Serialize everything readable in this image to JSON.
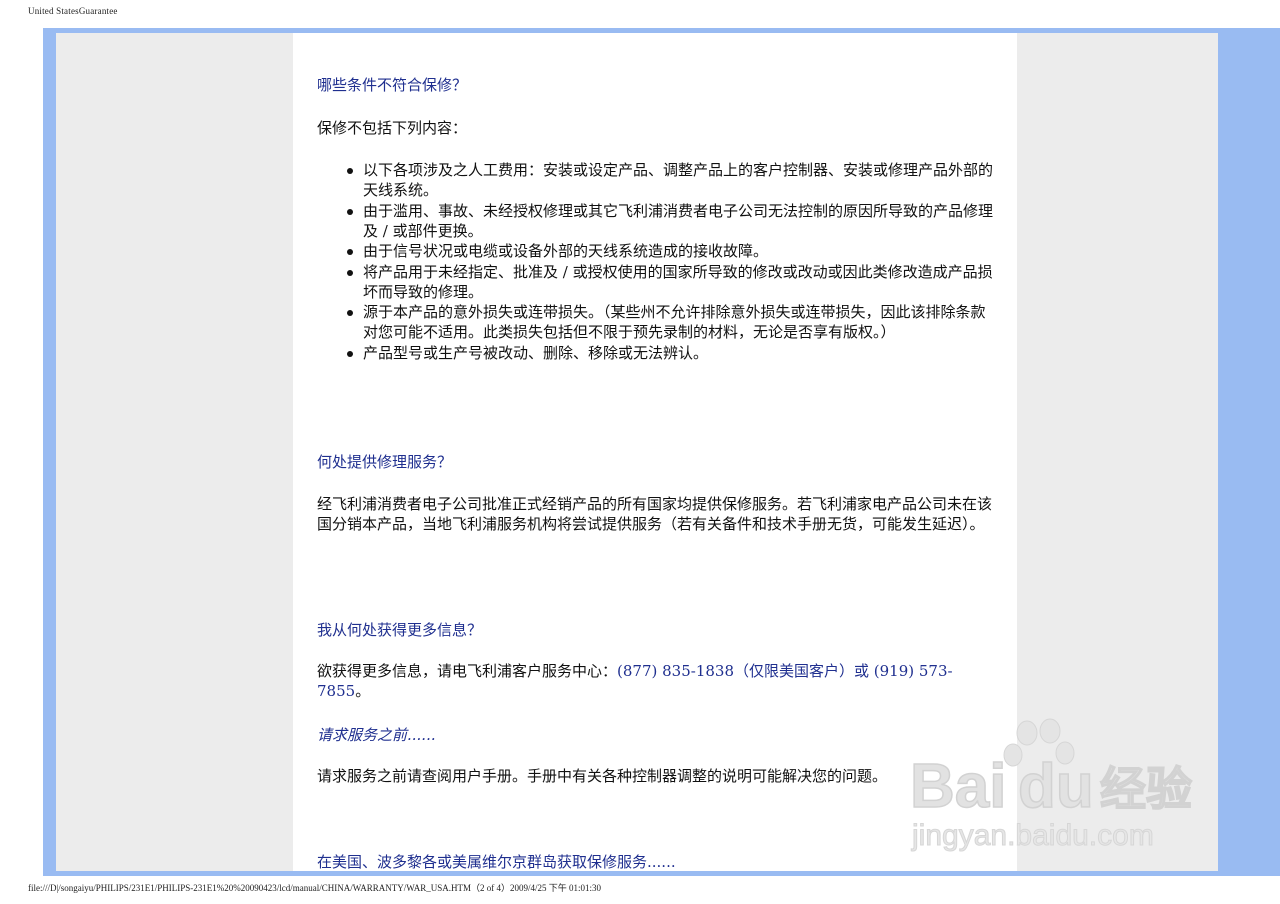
{
  "header": {
    "title": "United StatesGuarantee"
  },
  "sections": {
    "not_covered": {
      "heading": "哪些条件不符合保修？",
      "intro": "保修不包括下列内容：",
      "items": [
        "以下各项涉及之人工费用：安装或设定产品、调整产品上的客户控制器、安装或修理产品外部的天线系统。",
        "由于滥用、事故、未经授权修理或其它飞利浦消费者电子公司无法控制的原因所导致的产品修理及 / 或部件更换。",
        "由于信号状况或电缆或设备外部的天线系统造成的接收故障。",
        "将产品用于未经指定、批准及 / 或授权使用的国家所导致的修改或改动或因此类修改造成产品损坏而导致的修理。",
        "源于本产品的意外损失或连带损失。（某些州不允许排除意外损失或连带损失，因此该排除条款对您可能不适用。此类损失包括但不限于预先录制的材料，无论是否享有版权。）",
        "产品型号或生产号被改动、删除、移除或无法辨认。"
      ]
    },
    "where_service": {
      "heading": "何处提供修理服务？",
      "body": "经飞利浦消费者电子公司批准正式经销产品的所有国家均提供保修服务。若飞利浦家电产品公司未在该国分销本产品，当地飞利浦服务机构将尝试提供服务（若有关备件和技术手册无货，可能发生延迟）。"
    },
    "more_info": {
      "heading": "我从何处获得更多信息？",
      "body_prefix": "欲获得更多信息，请电飞利浦客户服务中心：",
      "phone_link": "(877) 835-1838（仅限美国客户）或 (919) 573-7855",
      "body_suffix": "。"
    },
    "before_service": {
      "heading": "请求服务之前......",
      "body": "请求服务之前请查阅用户手册。手册中有关各种控制器调整的说明可能解决您的问题。"
    },
    "usa_service": {
      "heading": "在美国、波多黎各或美属维尔京群岛获取保修服务......"
    }
  },
  "watermark": {
    "brand": "Bai",
    "brand2": "du",
    "cn": "经验",
    "url": "jingyan.baidu.com"
  },
  "footer": {
    "path": "file:///D|/songaiyu/PHILIPS/231E1/PHILIPS-231E1%20%20090423/lcd/manual/CHINA/WARRANTY/WAR_USA.HTM（2 of 4）2009/4/25 下午 01:01:30"
  },
  "colors": {
    "frame": "#99bbf2",
    "side": "#ececec",
    "heading": "#1f2f8f"
  }
}
